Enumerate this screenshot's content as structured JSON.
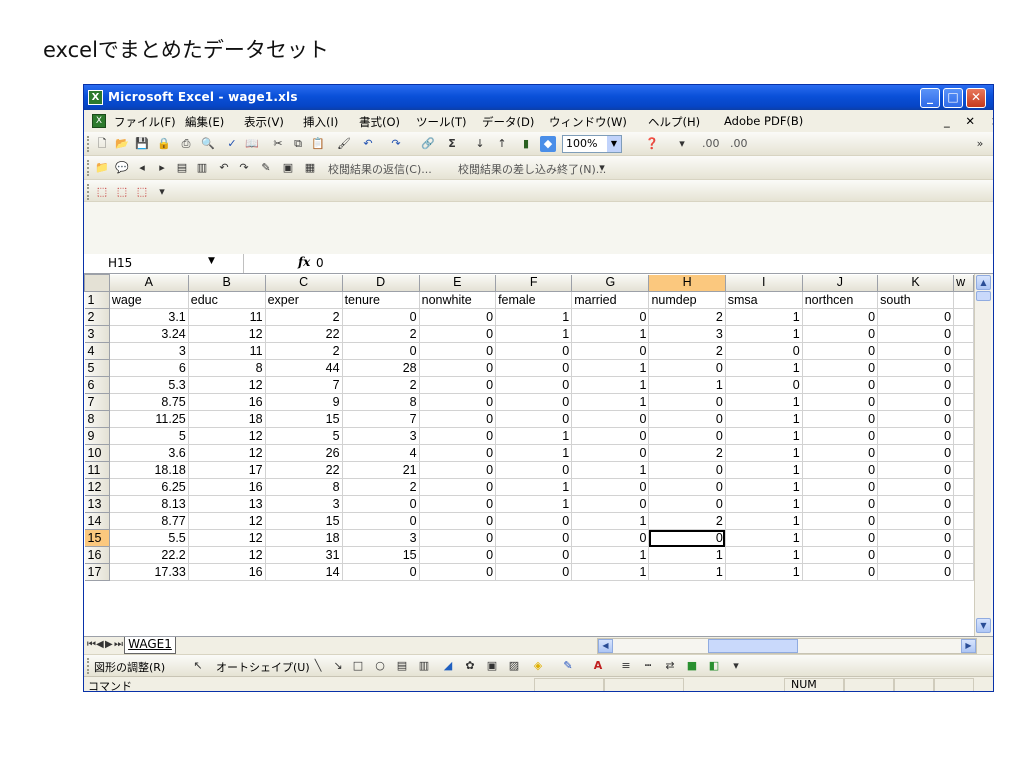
{
  "page_heading": "excelでまとめたデータセット",
  "window": {
    "title": "Microsoft Excel - wage1.xls",
    "app_icon": "excel-icon"
  },
  "menu": {
    "items": [
      "ファイル(F)",
      "編集(E)",
      "表示(V)",
      "挿入(I)",
      "書式(O)",
      "ツール(T)",
      "データ(D)",
      "ウィンドウ(W)",
      "ヘルプ(H)",
      "Adobe PDF(B)"
    ],
    "right_controls": "_ ✕ ×"
  },
  "toolbar": {
    "zoom": "100%",
    "decimal_labels": [
      ".00",
      ".00"
    ]
  },
  "review_toolbar": {
    "reply_with_changes": "校閲結果の返信(C)...",
    "end_review": "校閲結果の差し込み終了(N)..."
  },
  "formula_bar": {
    "name_box": "H15",
    "fx_label": "fx",
    "value": "0"
  },
  "sheet": {
    "columns": [
      "A",
      "B",
      "C",
      "D",
      "E",
      "F",
      "G",
      "H",
      "I",
      "J",
      "K"
    ],
    "partial_column_header": "w",
    "headers": [
      "wage",
      "educ",
      "exper",
      "tenure",
      "nonwhite",
      "female",
      "married",
      "numdep",
      "smsa",
      "northcen",
      "south"
    ],
    "rows": [
      [
        "3.1",
        "11",
        "2",
        "0",
        "0",
        "1",
        "0",
        "2",
        "1",
        "0",
        "0"
      ],
      [
        "3.24",
        "12",
        "22",
        "2",
        "0",
        "1",
        "1",
        "3",
        "1",
        "0",
        "0"
      ],
      [
        "3",
        "11",
        "2",
        "0",
        "0",
        "0",
        "0",
        "2",
        "0",
        "0",
        "0"
      ],
      [
        "6",
        "8",
        "44",
        "28",
        "0",
        "0",
        "1",
        "0",
        "1",
        "0",
        "0"
      ],
      [
        "5.3",
        "12",
        "7",
        "2",
        "0",
        "0",
        "1",
        "1",
        "0",
        "0",
        "0"
      ],
      [
        "8.75",
        "16",
        "9",
        "8",
        "0",
        "0",
        "1",
        "0",
        "1",
        "0",
        "0"
      ],
      [
        "11.25",
        "18",
        "15",
        "7",
        "0",
        "0",
        "0",
        "0",
        "1",
        "0",
        "0"
      ],
      [
        "5",
        "12",
        "5",
        "3",
        "0",
        "1",
        "0",
        "0",
        "1",
        "0",
        "0"
      ],
      [
        "3.6",
        "12",
        "26",
        "4",
        "0",
        "1",
        "0",
        "2",
        "1",
        "0",
        "0"
      ],
      [
        "18.18",
        "17",
        "22",
        "21",
        "0",
        "0",
        "1",
        "0",
        "1",
        "0",
        "0"
      ],
      [
        "6.25",
        "16",
        "8",
        "2",
        "0",
        "1",
        "0",
        "0",
        "1",
        "0",
        "0"
      ],
      [
        "8.13",
        "13",
        "3",
        "0",
        "0",
        "1",
        "0",
        "0",
        "1",
        "0",
        "0"
      ],
      [
        "8.77",
        "12",
        "15",
        "0",
        "0",
        "0",
        "1",
        "2",
        "1",
        "0",
        "0"
      ],
      [
        "5.5",
        "12",
        "18",
        "3",
        "0",
        "0",
        "0",
        "0",
        "1",
        "0",
        "0"
      ],
      [
        "22.2",
        "12",
        "31",
        "15",
        "0",
        "0",
        "1",
        "1",
        "1",
        "0",
        "0"
      ],
      [
        "17.33",
        "16",
        "14",
        "0",
        "0",
        "0",
        "1",
        "1",
        "1",
        "0",
        "0"
      ]
    ],
    "active_cell": {
      "row": 15,
      "col": "H"
    }
  },
  "sheet_tab": "WAGE1",
  "drawing_toolbar": {
    "adjust_shapes": "図形の調整(R)",
    "autoshapes": "オートシェイプ(U)"
  },
  "status": {
    "mode": "コマンド",
    "num": "NUM"
  }
}
